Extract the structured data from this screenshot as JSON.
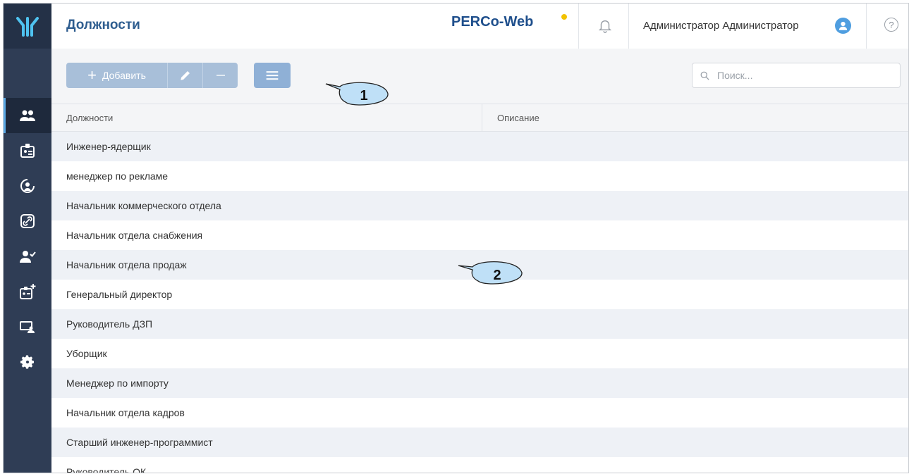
{
  "header": {
    "page_title": "Должности",
    "brand": "PERCo-Web",
    "user_name": "Администратор Администратор",
    "help_label": "?"
  },
  "toolbar": {
    "add_label": "Добавить",
    "search_placeholder": "Поиск..."
  },
  "table": {
    "columns": [
      "Должности",
      "Описание"
    ],
    "rows": [
      {
        "position": "Инженер-ядерщик",
        "description": ""
      },
      {
        "position": "менеджер по рекламе",
        "description": ""
      },
      {
        "position": "Начальник коммерческого отдела",
        "description": ""
      },
      {
        "position": "Начальник отдела снабжения",
        "description": ""
      },
      {
        "position": "Начальник отдела продаж",
        "description": ""
      },
      {
        "position": "Генеральный директор",
        "description": ""
      },
      {
        "position": "Руководитель ДЗП",
        "description": ""
      },
      {
        "position": "Уборщик",
        "description": ""
      },
      {
        "position": "Менеджер по импорту",
        "description": ""
      },
      {
        "position": "Начальник отдела кадров",
        "description": ""
      },
      {
        "position": "Старший инженер-программист",
        "description": ""
      },
      {
        "position": "Руководитель ОК",
        "description": ""
      }
    ]
  },
  "sidebar": {
    "items": [
      {
        "icon": "staff-icon",
        "active": true
      },
      {
        "icon": "badge-icon"
      },
      {
        "icon": "access-icon"
      },
      {
        "icon": "link-icon"
      },
      {
        "icon": "user-check-icon"
      },
      {
        "icon": "badge-add-icon"
      },
      {
        "icon": "monitor-user-icon"
      },
      {
        "icon": "gear-icon"
      }
    ]
  },
  "callouts": {
    "toolbar_marker": "1",
    "table_marker": "2"
  },
  "colors": {
    "sidebar": "#2f3d55",
    "accent": "#2e5d8f",
    "button": "#a8bfd9",
    "brand_dot": "#f2c200"
  }
}
